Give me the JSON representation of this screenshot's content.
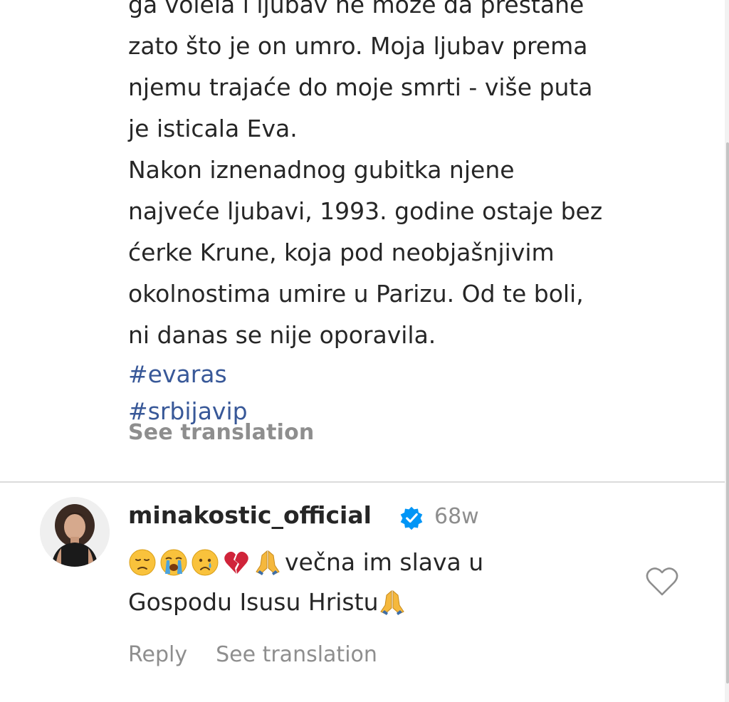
{
  "post": {
    "caption_lines": [
      "ga volela i ljubav ne može da prestane",
      "zato što je on umro. Moja ljubav prema",
      "njemu trajaće do moje smrti - više puta",
      "je isticala Eva.",
      "Nakon iznenadnog gubitka njene",
      "najveće ljubavi, 1993. godine ostaje bez",
      "ćerke Krune, koja pod neobjašnjivim",
      "okolnostima umire u Parizu. Od te boli,",
      "ni danas se nije oporavila."
    ],
    "hashtags": [
      "#evaras",
      "#srbijavip"
    ],
    "see_translation_label": "See translation"
  },
  "comment": {
    "username": "minakostic_official",
    "verified": true,
    "timestamp": "68w",
    "emoji_prefix": [
      "sad-face",
      "loudly-crying-face",
      "crying-face",
      "broken-heart",
      "folded-hands"
    ],
    "text_line1": "večna im slava u",
    "text_line2": "Gospodu Isusu Hristu",
    "emoji_suffix": [
      "folded-hands"
    ],
    "reply_label": "Reply",
    "see_translation_label": "See translation"
  },
  "colors": {
    "text": "#262626",
    "muted": "#8e8e8e",
    "hashtag": "#385898",
    "verified": "#0095f6",
    "divider": "#dbdbdb"
  }
}
